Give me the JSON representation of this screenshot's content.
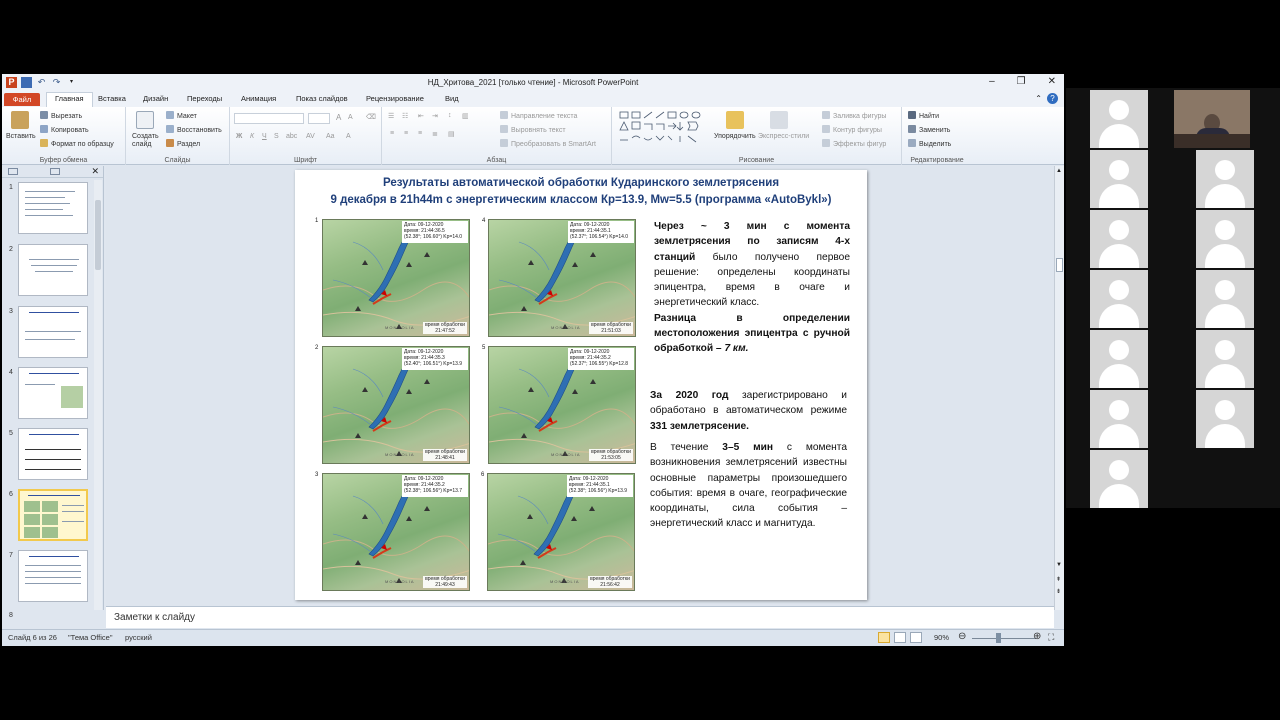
{
  "window": {
    "title": "НД_Хритова_2021 [только чтение] - Microsoft PowerPoint",
    "min_label": "–",
    "max_label": "❐",
    "close_label": "✕"
  },
  "tabs": [
    "Файл",
    "Главная",
    "Вставка",
    "Дизайн",
    "Переходы",
    "Анимация",
    "Показ слайдов",
    "Рецензирование",
    "Вид"
  ],
  "ribbon": {
    "clipboard": {
      "paste": "Вставить",
      "cut": "Вырезать",
      "copy": "Копировать",
      "format_painter": "Формат по образцу",
      "label": "Буфер обмена"
    },
    "slides": {
      "new_slide": "Создать слайд",
      "layout": "Макет",
      "reset": "Восстановить",
      "section": "Раздел",
      "label": "Слайды"
    },
    "font": {
      "label": "Шрифт"
    },
    "paragraph": {
      "text_direction": "Направление текста",
      "align_text": "Выровнять текст",
      "smartart": "Преобразовать в SmartArt",
      "label": "Абзац"
    },
    "drawing": {
      "arrange": "Упорядочить",
      "quick_styles": "Экспресс-стили",
      "fill": "Заливка фигуры",
      "outline": "Контур фигуры",
      "effects": "Эффекты фигур",
      "label": "Рисование"
    },
    "editing": {
      "find": "Найти",
      "replace": "Заменить",
      "select": "Выделить",
      "label": "Редактирование"
    }
  },
  "thumbnails": [
    "1",
    "2",
    "3",
    "4",
    "5",
    "6",
    "7",
    "8"
  ],
  "slide": {
    "title_line1": "Результаты автоматической обработки Кударинского землетрясения",
    "title_line2": "9 декабря в 21h44m с энергетическим классом Кр=13.9, Mw=5.5 (программа «AutoBykl»)",
    "maps": [
      {
        "num": "1",
        "info1": "Дата: 09-12-2020",
        "info2": "время: 21:44:36.5",
        "info3": "(52.38°; 106.60°) Kp=14.0",
        "time_label": "время обработки",
        "time": "21:47:52",
        "region": "MONGOLIA"
      },
      {
        "num": "4",
        "info1": "Дата: 09-12-2020",
        "info2": "время: 21:44:35.1",
        "info3": "(52.37°; 106.54°) Kp=14.0",
        "time_label": "время обработки",
        "time": "21:51:03",
        "region": "MONGOLIA"
      },
      {
        "num": "2",
        "info1": "Дата: 09-12-2020",
        "info2": "время: 21:44:35.3",
        "info3": "(52.40°; 106.51°) Kp=13.9",
        "time_label": "время обработки",
        "time": "21:48:41",
        "region": "MONGOLIA"
      },
      {
        "num": "5",
        "info1": "Дата: 09-12-2020",
        "info2": "время: 21:44:35.2",
        "info3": "(52.37°; 106.55°) Kp=12.8",
        "time_label": "время обработки",
        "time": "21:53:05",
        "region": "MONGOLIA"
      },
      {
        "num": "3",
        "info1": "Дата: 09-12-2020",
        "info2": "время: 21:44:35.2",
        "info3": "(52.38°; 106.56°) Kp=13.7",
        "time_label": "время обработки",
        "time": "21:49:43",
        "region": "MONGOLIA"
      },
      {
        "num": "6",
        "info1": "Дата: 09-12-2020",
        "info2": "время: 21:44:35.1",
        "info3": "(52.38°; 106.56°) Kp=13.9",
        "time_label": "время обработки",
        "time": "21:56:42",
        "region": "MONGOLIA"
      }
    ],
    "p1_bold": "Через ~ 3 мин с момента землетрясения по записям 4-х станций",
    "p1_rest": " было получено первое решение: определены координаты эпицентра, время в очаге и энергетический класс.",
    "p2_bold": "Разница в определении местоположения эпицентра с ручной обработкой –",
    "p2_italic": " 7 км.",
    "p3_a": "За 2020 год",
    "p3_b": " зарегистрировано и обработано в автоматическом режиме ",
    "p3_c": "331 землетрясение.",
    "p4_a": "В течение ",
    "p4_b": "3–5 мин",
    "p4_c": " с момента возникновения землетрясений известны основные параметры произошедшего события: время в очаге, географические координаты, сила события – энергетический класс и магнитуда."
  },
  "notes_placeholder": "Заметки к слайду",
  "status": {
    "slide_info": "Слайд 6 из 26",
    "theme": "\"Тема Office\"",
    "language": "русский",
    "zoom": "90%"
  },
  "colors": {
    "accent": "#d24726",
    "title_blue": "#1f3f7a",
    "selection": "#f2c94c"
  }
}
